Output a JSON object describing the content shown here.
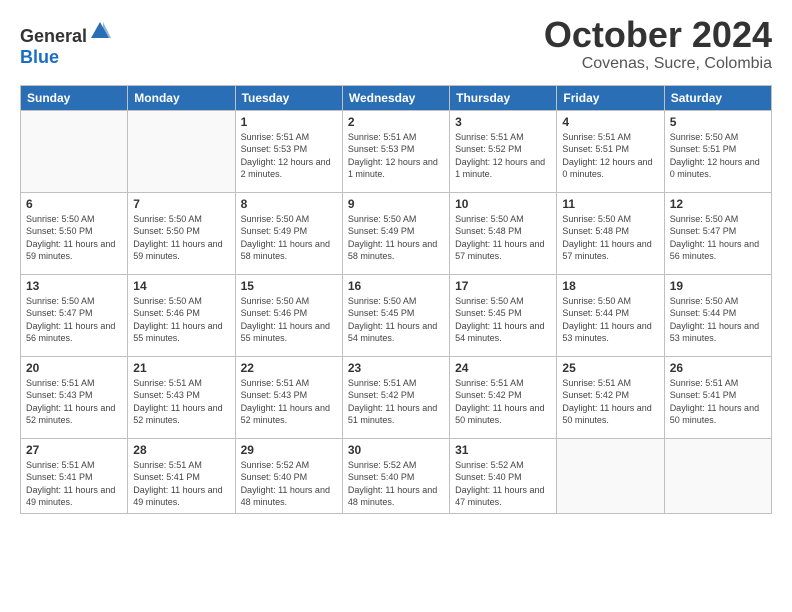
{
  "header": {
    "logo_general": "General",
    "logo_blue": "Blue",
    "title": "October 2024",
    "subtitle": "Covenas, Sucre, Colombia"
  },
  "weekdays": [
    "Sunday",
    "Monday",
    "Tuesday",
    "Wednesday",
    "Thursday",
    "Friday",
    "Saturday"
  ],
  "weeks": [
    [
      {
        "day": "",
        "empty": true
      },
      {
        "day": "",
        "empty": true
      },
      {
        "day": "1",
        "sunrise": "Sunrise: 5:51 AM",
        "sunset": "Sunset: 5:53 PM",
        "daylight": "Daylight: 12 hours and 2 minutes."
      },
      {
        "day": "2",
        "sunrise": "Sunrise: 5:51 AM",
        "sunset": "Sunset: 5:53 PM",
        "daylight": "Daylight: 12 hours and 1 minute."
      },
      {
        "day": "3",
        "sunrise": "Sunrise: 5:51 AM",
        "sunset": "Sunset: 5:52 PM",
        "daylight": "Daylight: 12 hours and 1 minute."
      },
      {
        "day": "4",
        "sunrise": "Sunrise: 5:51 AM",
        "sunset": "Sunset: 5:51 PM",
        "daylight": "Daylight: 12 hours and 0 minutes."
      },
      {
        "day": "5",
        "sunrise": "Sunrise: 5:50 AM",
        "sunset": "Sunset: 5:51 PM",
        "daylight": "Daylight: 12 hours and 0 minutes."
      }
    ],
    [
      {
        "day": "6",
        "sunrise": "Sunrise: 5:50 AM",
        "sunset": "Sunset: 5:50 PM",
        "daylight": "Daylight: 11 hours and 59 minutes."
      },
      {
        "day": "7",
        "sunrise": "Sunrise: 5:50 AM",
        "sunset": "Sunset: 5:50 PM",
        "daylight": "Daylight: 11 hours and 59 minutes."
      },
      {
        "day": "8",
        "sunrise": "Sunrise: 5:50 AM",
        "sunset": "Sunset: 5:49 PM",
        "daylight": "Daylight: 11 hours and 58 minutes."
      },
      {
        "day": "9",
        "sunrise": "Sunrise: 5:50 AM",
        "sunset": "Sunset: 5:49 PM",
        "daylight": "Daylight: 11 hours and 58 minutes."
      },
      {
        "day": "10",
        "sunrise": "Sunrise: 5:50 AM",
        "sunset": "Sunset: 5:48 PM",
        "daylight": "Daylight: 11 hours and 57 minutes."
      },
      {
        "day": "11",
        "sunrise": "Sunrise: 5:50 AM",
        "sunset": "Sunset: 5:48 PM",
        "daylight": "Daylight: 11 hours and 57 minutes."
      },
      {
        "day": "12",
        "sunrise": "Sunrise: 5:50 AM",
        "sunset": "Sunset: 5:47 PM",
        "daylight": "Daylight: 11 hours and 56 minutes."
      }
    ],
    [
      {
        "day": "13",
        "sunrise": "Sunrise: 5:50 AM",
        "sunset": "Sunset: 5:47 PM",
        "daylight": "Daylight: 11 hours and 56 minutes."
      },
      {
        "day": "14",
        "sunrise": "Sunrise: 5:50 AM",
        "sunset": "Sunset: 5:46 PM",
        "daylight": "Daylight: 11 hours and 55 minutes."
      },
      {
        "day": "15",
        "sunrise": "Sunrise: 5:50 AM",
        "sunset": "Sunset: 5:46 PM",
        "daylight": "Daylight: 11 hours and 55 minutes."
      },
      {
        "day": "16",
        "sunrise": "Sunrise: 5:50 AM",
        "sunset": "Sunset: 5:45 PM",
        "daylight": "Daylight: 11 hours and 54 minutes."
      },
      {
        "day": "17",
        "sunrise": "Sunrise: 5:50 AM",
        "sunset": "Sunset: 5:45 PM",
        "daylight": "Daylight: 11 hours and 54 minutes."
      },
      {
        "day": "18",
        "sunrise": "Sunrise: 5:50 AM",
        "sunset": "Sunset: 5:44 PM",
        "daylight": "Daylight: 11 hours and 53 minutes."
      },
      {
        "day": "19",
        "sunrise": "Sunrise: 5:50 AM",
        "sunset": "Sunset: 5:44 PM",
        "daylight": "Daylight: 11 hours and 53 minutes."
      }
    ],
    [
      {
        "day": "20",
        "sunrise": "Sunrise: 5:51 AM",
        "sunset": "Sunset: 5:43 PM",
        "daylight": "Daylight: 11 hours and 52 minutes."
      },
      {
        "day": "21",
        "sunrise": "Sunrise: 5:51 AM",
        "sunset": "Sunset: 5:43 PM",
        "daylight": "Daylight: 11 hours and 52 minutes."
      },
      {
        "day": "22",
        "sunrise": "Sunrise: 5:51 AM",
        "sunset": "Sunset: 5:43 PM",
        "daylight": "Daylight: 11 hours and 52 minutes."
      },
      {
        "day": "23",
        "sunrise": "Sunrise: 5:51 AM",
        "sunset": "Sunset: 5:42 PM",
        "daylight": "Daylight: 11 hours and 51 minutes."
      },
      {
        "day": "24",
        "sunrise": "Sunrise: 5:51 AM",
        "sunset": "Sunset: 5:42 PM",
        "daylight": "Daylight: 11 hours and 50 minutes."
      },
      {
        "day": "25",
        "sunrise": "Sunrise: 5:51 AM",
        "sunset": "Sunset: 5:42 PM",
        "daylight": "Daylight: 11 hours and 50 minutes."
      },
      {
        "day": "26",
        "sunrise": "Sunrise: 5:51 AM",
        "sunset": "Sunset: 5:41 PM",
        "daylight": "Daylight: 11 hours and 50 minutes."
      }
    ],
    [
      {
        "day": "27",
        "sunrise": "Sunrise: 5:51 AM",
        "sunset": "Sunset: 5:41 PM",
        "daylight": "Daylight: 11 hours and 49 minutes."
      },
      {
        "day": "28",
        "sunrise": "Sunrise: 5:51 AM",
        "sunset": "Sunset: 5:41 PM",
        "daylight": "Daylight: 11 hours and 49 minutes."
      },
      {
        "day": "29",
        "sunrise": "Sunrise: 5:52 AM",
        "sunset": "Sunset: 5:40 PM",
        "daylight": "Daylight: 11 hours and 48 minutes."
      },
      {
        "day": "30",
        "sunrise": "Sunrise: 5:52 AM",
        "sunset": "Sunset: 5:40 PM",
        "daylight": "Daylight: 11 hours and 48 minutes."
      },
      {
        "day": "31",
        "sunrise": "Sunrise: 5:52 AM",
        "sunset": "Sunset: 5:40 PM",
        "daylight": "Daylight: 11 hours and 47 minutes."
      },
      {
        "day": "",
        "empty": true
      },
      {
        "day": "",
        "empty": true
      }
    ]
  ]
}
